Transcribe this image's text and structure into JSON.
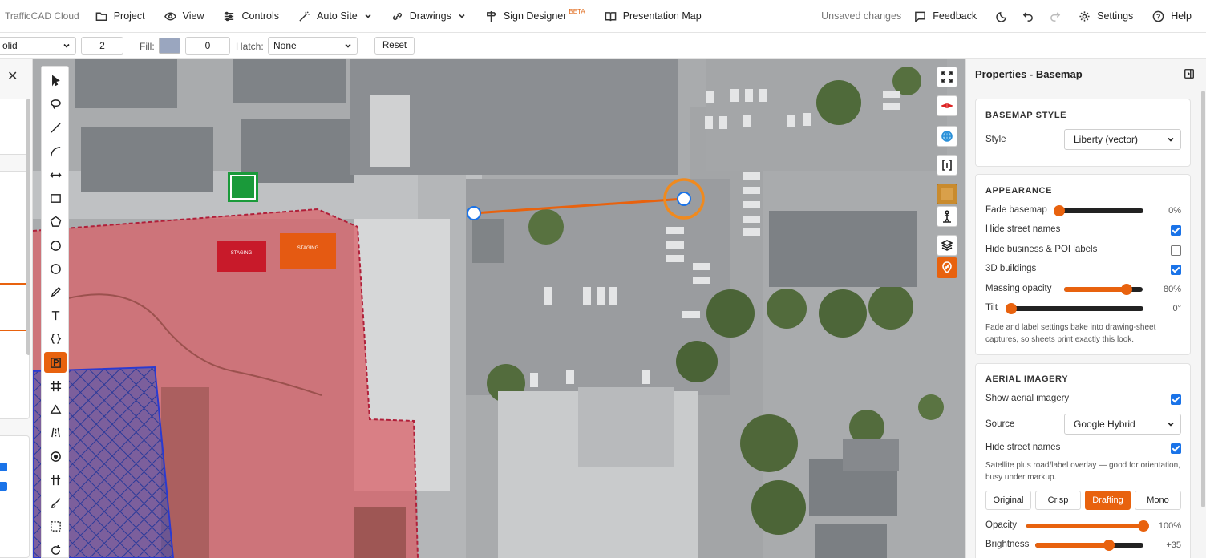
{
  "app": {
    "brand": "TrafficCAD Cloud"
  },
  "menu": [
    {
      "label": "Project",
      "icon": "folder-icon"
    },
    {
      "label": "View",
      "icon": "eye-icon"
    },
    {
      "label": "Controls",
      "icon": "sliders-icon"
    },
    {
      "label": "Auto Site",
      "icon": "magic-wand-icon"
    },
    {
      "label": "Drawings",
      "icon": "link-icon"
    },
    {
      "label": "Sign Designer",
      "icon": "signpost-icon",
      "badge": "BETA"
    },
    {
      "label": "Presentation Map",
      "icon": "book-icon"
    }
  ],
  "status": {
    "unsaved": "Unsaved changes"
  },
  "header_right": {
    "feedback": "Feedback",
    "settings": "Settings",
    "help": "Help"
  },
  "toolbar": {
    "line_style": "olid",
    "line_width": "2",
    "fill_label": "Fill:",
    "fill_color": "#9aa6bf",
    "fill_value": "0",
    "hatch_label": "Hatch:",
    "hatch_value": "None",
    "reset_label": "Reset"
  },
  "map_labels": {
    "sign_red": "STAGING",
    "sign_orange": "STAGING"
  },
  "properties": {
    "title": "Properties - Basemap",
    "basemap_style": {
      "title": "BASEMAP STYLE",
      "style_label": "Style",
      "style_value": "Liberty (vector)"
    },
    "appearance": {
      "title": "APPEARANCE",
      "fade_label": "Fade basemap",
      "fade_value": "0%",
      "fade_level": 0,
      "hide_street_names_label": "Hide street names",
      "hide_street_names": true,
      "hide_poi_label": "Hide business & POI labels",
      "hide_poi": false,
      "buildings_3d_label": "3D buildings",
      "buildings_3d": true,
      "massing_label": "Massing opacity",
      "massing_value": "80%",
      "massing_level": 0.8,
      "tilt_label": "Tilt",
      "tilt_value": "0°",
      "tilt_level": 0,
      "note": "Fade and label settings bake into drawing-sheet captures, so sheets print exactly this look."
    },
    "aerial": {
      "title": "AERIAL IMAGERY",
      "show_label": "Show aerial imagery",
      "show": true,
      "source_label": "Source",
      "source_value": "Google Hybrid",
      "hide_street_names_label": "Hide street names",
      "hide_street_names": true,
      "note": "Satellite plus road/label overlay — good for orientation, busy under markup.",
      "modes": [
        "Original",
        "Crisp",
        "Drafting",
        "Mono"
      ],
      "active_mode": "Drafting",
      "opacity_label": "Opacity",
      "opacity_value": "100%",
      "opacity_level": 1.0,
      "brightness_label": "Brightness",
      "brightness_value": "+35",
      "brightness_level": 0.68
    }
  },
  "colors": {
    "accent": "#e8620e",
    "checkbox": "#1a73e8",
    "zone_red": "#d9626a",
    "zone_blue": "#3a4fb8"
  }
}
